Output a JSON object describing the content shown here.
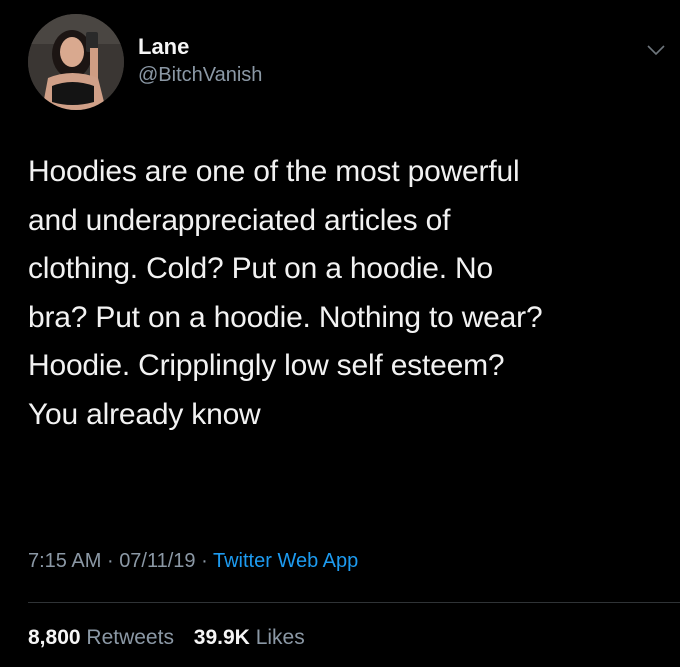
{
  "user": {
    "display_name": "Lane",
    "handle": "@BitchVanish",
    "avatar_icon": "profile-photo-avatar"
  },
  "tweet": {
    "text": "Hoodies are one of the most powerful\nand underappreciated articles of\nclothing. Cold? Put on a hoodie. No\nbra? Put on a hoodie. Nothing to wear?\nHoodie. Cripplingly low self esteem?\nYou already know",
    "time": "7:15 AM",
    "separator": "·",
    "date": "07/11/19",
    "source": "Twitter Web App"
  },
  "stats": {
    "retweets_count": "8,800",
    "retweets_label": "Retweets",
    "likes_count": "39.9K",
    "likes_label": "Likes"
  },
  "colors": {
    "background": "#000000",
    "text": "#f2f2f2",
    "muted": "#8b98a5",
    "link": "#1d9bf0",
    "divider": "#2f3336"
  }
}
